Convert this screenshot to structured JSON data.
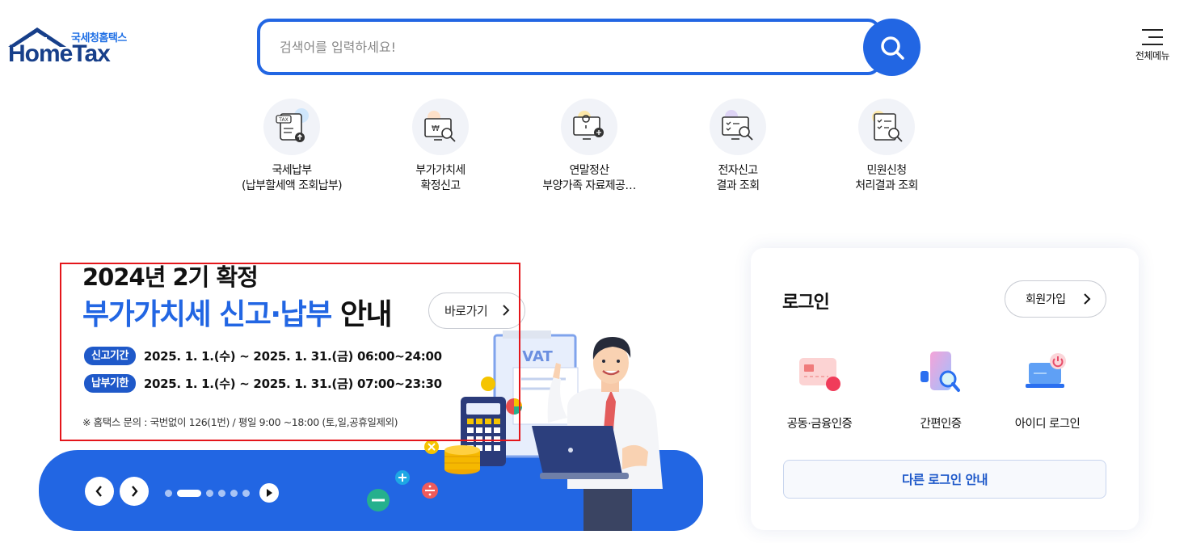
{
  "header": {
    "logo_sub": "국세청홈택스",
    "logo_main": "HomeTax",
    "search_placeholder": "검색어를 입력하세요!",
    "menu_label": "전체메뉴"
  },
  "quick_menu": [
    {
      "line1": "국세납부",
      "line2": "(납부할세액 조회납부)",
      "icon": "tax-payment-icon"
    },
    {
      "line1": "부가가치세",
      "line2": "확정신고",
      "icon": "vat-report-icon"
    },
    {
      "line1": "연말정산",
      "line2": "부양가족 자료제공…",
      "icon": "year-end-settlement-icon"
    },
    {
      "line1": "전자신고",
      "line2": "결과 조회",
      "icon": "e-filing-result-icon"
    },
    {
      "line1": "민원신청",
      "line2": "처리결과 조회",
      "icon": "civil-request-icon"
    }
  ],
  "banner": {
    "title_line1": "2024년 2기 확정",
    "title_line2_blue": "부가가치세 신고·납부",
    "title_line2_black": "안내",
    "goto_label": "바로가기",
    "report_tag": "신고기간",
    "report_period": "2025. 1. 1.(수) ~ 2025. 1. 31.(금) 06:00~24:00",
    "payment_tag": "납부기한",
    "payment_period": "2025. 1. 1.(수) ~ 2025. 1. 31.(금) 07:00~23:30",
    "notice": "※ 홈택스 문의 : 국번없이 126(1번) / 평일 9:00 ~18:00 (토,일,공휴일제외)",
    "vat_sign": "VAT",
    "slide_count": 6,
    "active_slide": 2
  },
  "login": {
    "title": "로그인",
    "join_label": "회원가입",
    "options": [
      {
        "label": "공동·금융인증",
        "icon": "certificate-card-icon"
      },
      {
        "label": "간편인증",
        "icon": "phone-auth-icon"
      },
      {
        "label": "아이디 로그인",
        "icon": "laptop-id-icon"
      }
    ],
    "other_label": "다른 로그인 안내"
  },
  "colors": {
    "primary": "#2266e3",
    "navy": "#173f8a",
    "highlight_box": "#e4161b"
  }
}
